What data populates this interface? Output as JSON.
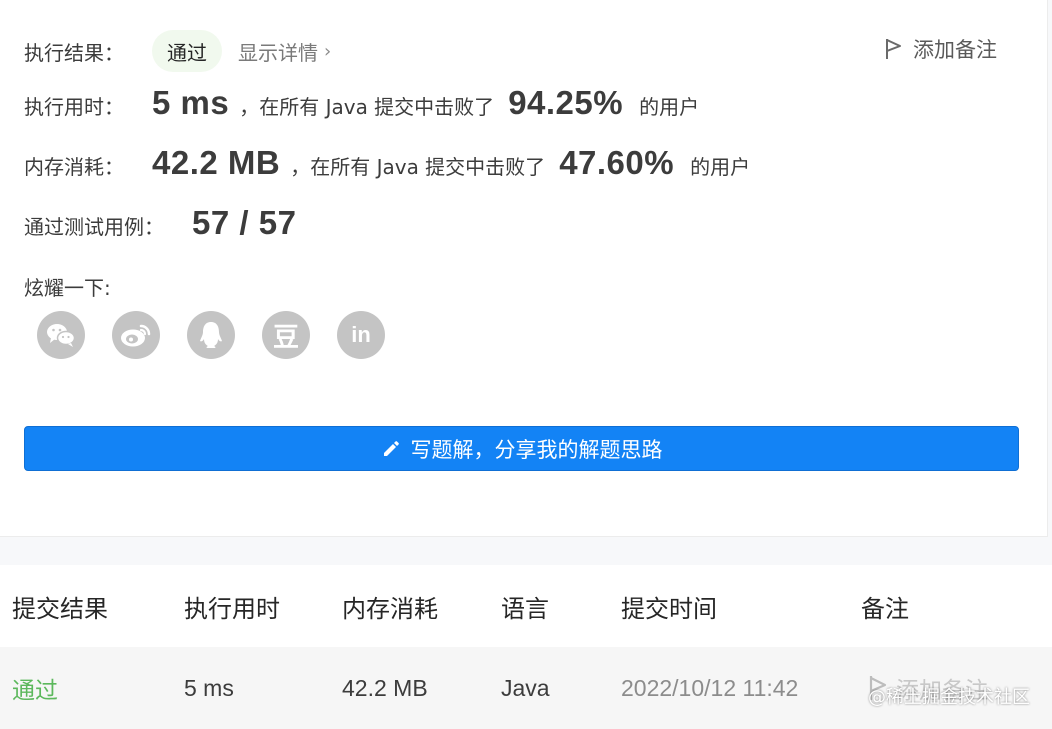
{
  "result": {
    "label": "执行结果：",
    "status": "通过",
    "details_link": "显示详情",
    "add_note": "添加备注"
  },
  "runtime": {
    "label": "执行用时：",
    "value": "5 ms",
    "mid_text": "，在所有 Java 提交中击败了",
    "percent": "94.25%",
    "suffix": "的用户"
  },
  "memory": {
    "label": "内存消耗：",
    "value": "42.2 MB",
    "mid_text": "，在所有 Java 提交中击败了",
    "percent": "47.60%",
    "suffix": "的用户"
  },
  "tests": {
    "label": "通过测试用例：",
    "value": "57 / 57"
  },
  "share": {
    "label": "炫耀一下:",
    "icons": [
      "wechat-icon",
      "weibo-icon",
      "qq-icon",
      "douban-icon",
      "linkedin-icon"
    ],
    "douban_glyph": "豆",
    "linkedin_glyph": "in"
  },
  "write_button": {
    "label": "写题解，分享我的解题思路"
  },
  "table": {
    "headers": [
      "提交结果",
      "执行用时",
      "内存消耗",
      "语言",
      "提交时间",
      "备注"
    ],
    "rows": [
      {
        "status": "通过",
        "runtime": "5 ms",
        "memory": "42.2 MB",
        "language": "Java",
        "time": "2022/10/12 11:42",
        "note": "添加备注"
      }
    ]
  },
  "watermark": "@稀土掘金技术社区",
  "colors": {
    "accent_blue": "#1383f5",
    "pass_green": "#5cb85c",
    "icon_gray": "#c4c4c4"
  }
}
